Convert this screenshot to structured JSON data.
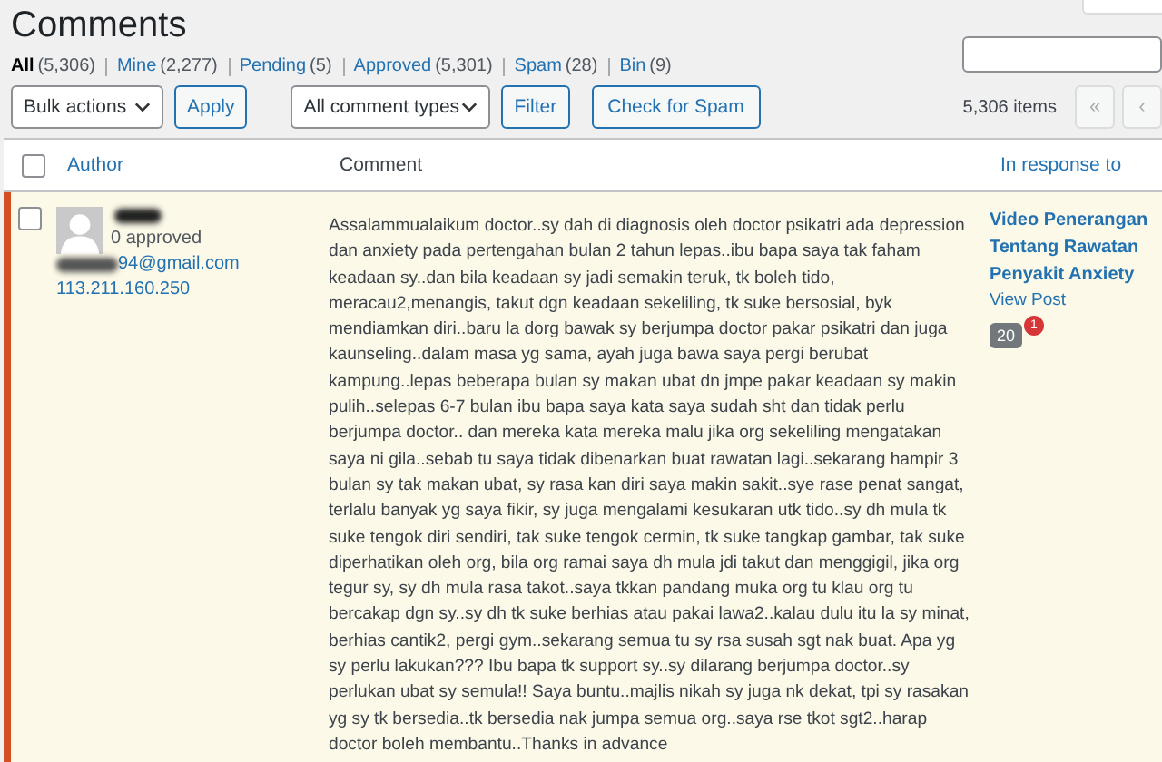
{
  "page": {
    "title": "Comments"
  },
  "filters": [
    {
      "label": "All",
      "count": "(5,306)",
      "selected": true
    },
    {
      "label": "Mine",
      "count": "(2,277)",
      "selected": false
    },
    {
      "label": "Pending",
      "count": "(5)",
      "selected": false
    },
    {
      "label": "Approved",
      "count": "(5,301)",
      "selected": false
    },
    {
      "label": "Spam",
      "count": "(28)",
      "selected": false
    },
    {
      "label": "Bin",
      "count": "(9)",
      "selected": false
    }
  ],
  "toolbar": {
    "bulk_actions": "Bulk actions",
    "apply": "Apply",
    "comment_types": "All comment types",
    "filter": "Filter",
    "check_spam": "Check for Spam",
    "items_count": "5,306 items",
    "pagination": [
      "«",
      "‹"
    ]
  },
  "table": {
    "select_all_checked": false,
    "columns": [
      "Author",
      "Comment",
      "In response to"
    ],
    "rows": [
      {
        "checked": false,
        "unapproved": true,
        "author_approved": "0 approved",
        "author_email": "94@gmail.com",
        "author_ip": "113.211.160.250",
        "comment": "Assalammualaikum doctor..sy dah di diagnosis oleh doctor psikatri ada depression dan anxiety pada pertengahan bulan 2 tahun lepas..ibu bapa saya tak faham keadaan sy..dan bila keadaan sy jadi semakin teruk, tk boleh tido, meracau2,menangis, takut dgn keadaan sekeliling, tk suke bersosial, byk mendiamkan diri..baru la dorg bawak sy berjumpa doctor pakar psikatri dan juga kaunseling..dalam masa yg sama, ayah juga bawa saya pergi berubat kampung..lepas beberapa bulan sy makan ubat dn jmpe pakar keadaan sy makin pulih..selepas 6-7 bulan ibu bapa saya kata saya sudah sht dan tidak perlu berjumpa doctor.. dan mereka kata mereka malu jika org sekeliling mengatakan saya ni gila..sebab tu saya tidak dibenarkan buat rawatan lagi..sekarang hampir 3 bulan sy tak makan ubat, sy rasa kan diri saya makin sakit..sye rase penat sangat, terlalu banyak yg saya fikir, sy juga mengalami kesukaran utk tido..sy dh mula tk suke tengok diri sendiri, tak suke tengok cermin, tk suke tangkap gambar, tak suke diperhatikan oleh org, bila org ramai saya dh mula jdi takut dan menggigil, jika org tegur sy, sy dh mula rasa takot..saya tkkan pandang muka org tu klau org tu bercakap dgn sy..sy dh tk suke berhias atau pakai lawa2..kalau dulu itu la sy minat, berhias cantik2, pergi gym..sekarang semua tu sy rsa susah sgt nak buat. Apa yg sy perlu lakukan??? Ibu bapa tk support sy..sy dilarang berjumpa doctor..sy perlukan ubat sy semula!! Saya buntu..majlis nikah sy juga nk dekat, tpi sy rasakan yg sy tk bersedia..tk bersedia nak jumpa semua org..saya rse tkot sgt2..harap doctor boleh membantu..Thanks in advance",
        "post_title": "Video Penerangan Tentang Rawatan Penyakit Anxiety",
        "view_post": "View Post",
        "comment_count": "20",
        "pending_count": "1"
      }
    ]
  }
}
